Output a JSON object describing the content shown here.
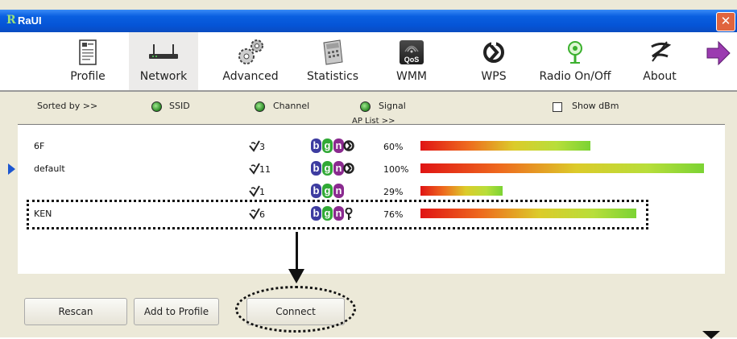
{
  "window": {
    "title": "RaUI",
    "logo": "R"
  },
  "toolbar": {
    "items": [
      {
        "label": "Profile",
        "icon": "profile-icon"
      },
      {
        "label": "Network",
        "icon": "network-router-icon",
        "active": true
      },
      {
        "label": "Advanced",
        "icon": "gears-icon"
      },
      {
        "label": "Statistics",
        "icon": "calculator-icon"
      },
      {
        "label": "WMM",
        "icon": "qos-icon"
      },
      {
        "label": "WPS",
        "icon": "wps-icon"
      },
      {
        "label": "Radio On/Off",
        "icon": "radio-icon"
      },
      {
        "label": "About",
        "icon": "about-icon"
      }
    ],
    "more_icon": "arrow-right-icon",
    "qos_text": "QoS"
  },
  "sortbar": {
    "sorted_by": "Sorted by >>",
    "ssid": "SSID",
    "channel": "Channel",
    "signal": "Signal",
    "show_dbm": "Show dBm",
    "ap_list": "AP List >>"
  },
  "ap_list": [
    {
      "ssid": "6F",
      "channel": "3",
      "b": "b",
      "g": "g",
      "n": "n",
      "security": "wps",
      "signal": "60%",
      "signal_value": 60,
      "selected": false
    },
    {
      "ssid": "default",
      "channel": "11",
      "b": "b",
      "g": "g",
      "n": "n",
      "security": "wps",
      "signal": "100%",
      "signal_value": 100,
      "selected": true
    },
    {
      "ssid": "",
      "channel": "1",
      "b": "b",
      "g": "g",
      "n": "n",
      "security": "",
      "signal": "29%",
      "signal_value": 29,
      "selected": false
    },
    {
      "ssid": "KEN",
      "channel": "6",
      "b": "b",
      "g": "g",
      "n": "n",
      "security": "key",
      "signal": "76%",
      "signal_value": 76,
      "selected": false
    }
  ],
  "buttons": {
    "rescan": "Rescan",
    "add_to_profile": "Add to Profile",
    "connect": "Connect"
  }
}
